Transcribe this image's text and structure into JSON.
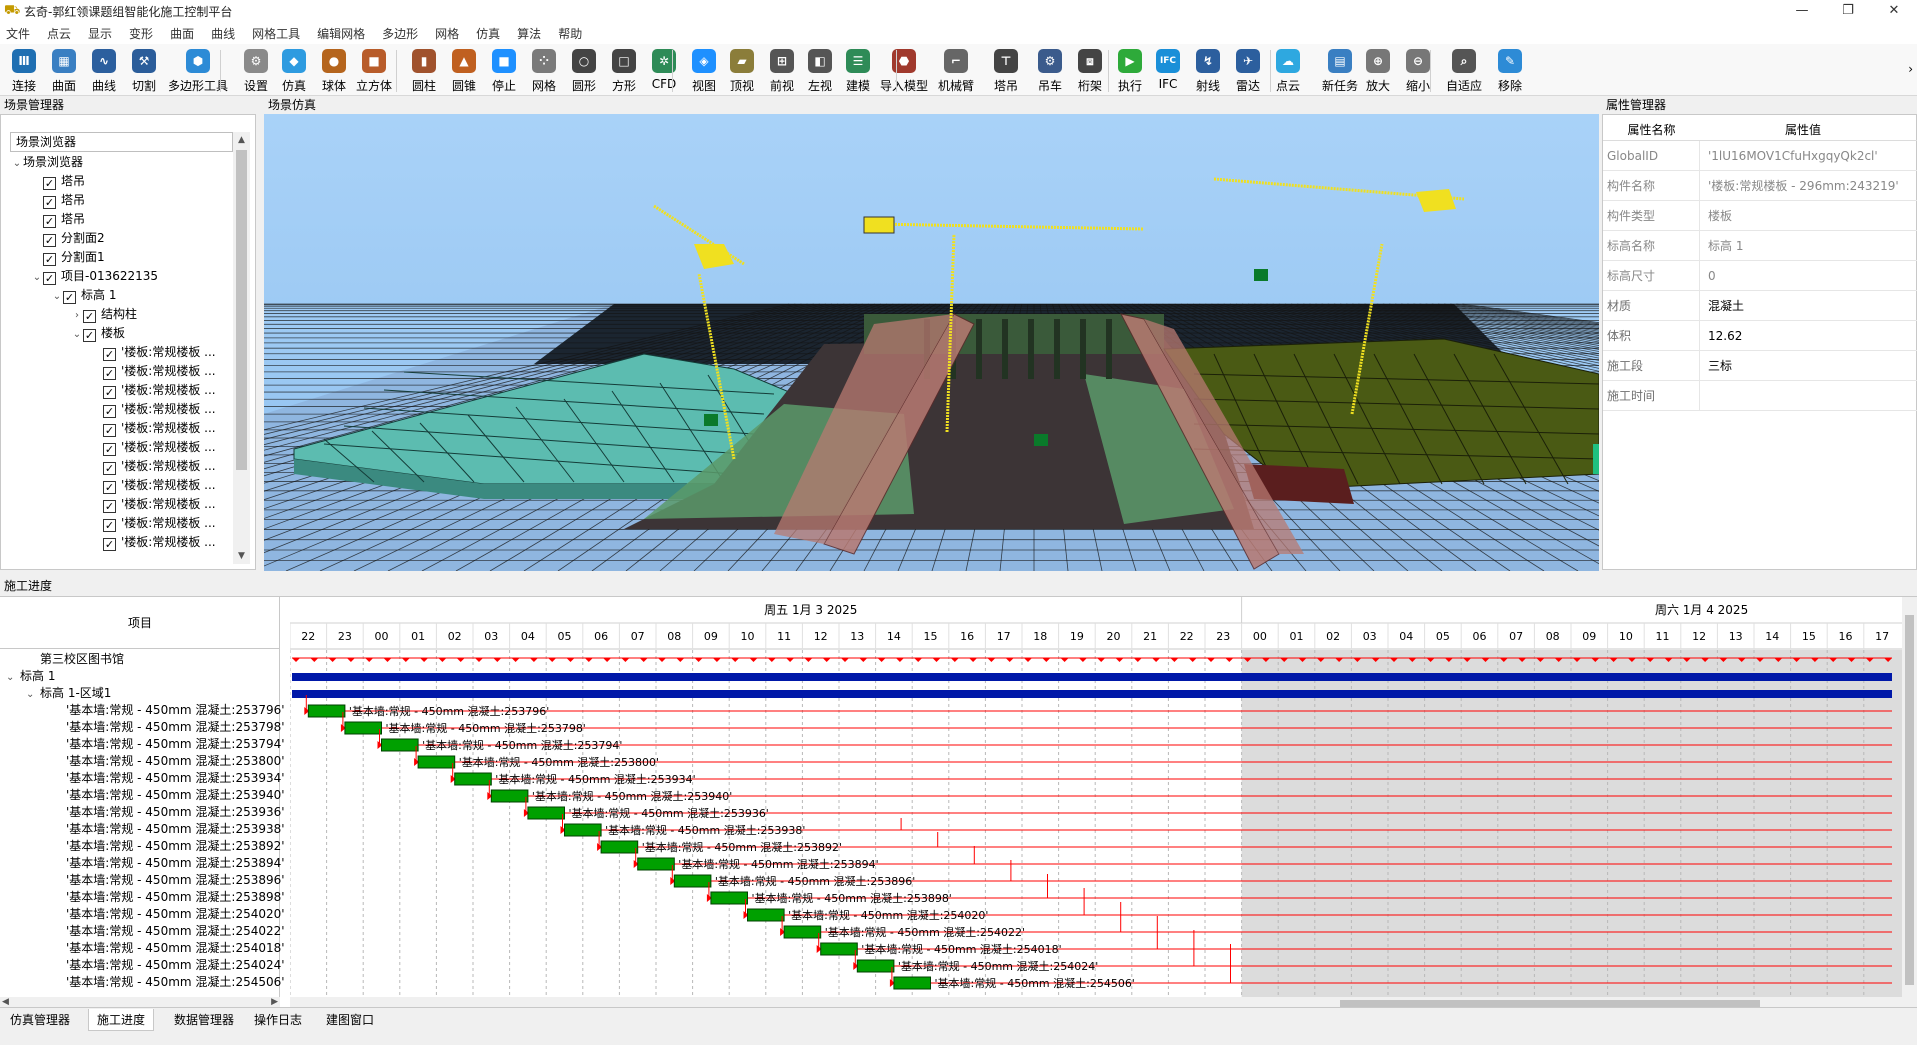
{
  "window": {
    "title": "玄奇-郭红领课题组智能化施工控制平台",
    "icon": "app-logo-icon",
    "min": "—",
    "max": "❐",
    "close": "✕"
  },
  "menu": [
    "文件",
    "点云",
    "显示",
    "变形",
    "曲面",
    "曲线",
    "网格工具",
    "编辑网格",
    "多边形",
    "网格",
    "仿真",
    "算法",
    "帮助"
  ],
  "toolbar": [
    {
      "label": "连接",
      "icon": "connect-icon",
      "color": "#1f6fb2",
      "glyph": "Ⅲ"
    },
    {
      "label": "曲面",
      "icon": "surface-icon",
      "color": "#3a7fc2",
      "glyph": "▦"
    },
    {
      "label": "曲线",
      "icon": "curve-icon",
      "color": "#2c5f9e",
      "glyph": "∿"
    },
    {
      "label": "切割",
      "icon": "cut-icon",
      "color": "#2b5d9a",
      "glyph": "⚒"
    },
    {
      "label": "多边形工具",
      "icon": "polygon-tool-icon",
      "color": "#2d8bd6",
      "glyph": "⬢"
    },
    {
      "label": "设置",
      "icon": "settings-icon",
      "color": "#8a8a8a",
      "glyph": "⚙"
    },
    {
      "label": "仿真",
      "icon": "simulation-icon",
      "color": "#2e9be0",
      "glyph": "◆"
    },
    {
      "label": "球体",
      "icon": "sphere-icon",
      "color": "#b5651d",
      "glyph": "●"
    },
    {
      "label": "立方体",
      "icon": "cube-icon",
      "color": "#b85c2a",
      "glyph": "■"
    },
    {
      "label": "圆柱",
      "icon": "cylinder-icon",
      "color": "#a0522d",
      "glyph": "▮"
    },
    {
      "label": "圆锥",
      "icon": "cone-icon",
      "color": "#c06020",
      "glyph": "▲"
    },
    {
      "label": "停止",
      "icon": "stop-icon",
      "color": "#1e90ff",
      "glyph": "■"
    },
    {
      "label": "网格",
      "icon": "mesh-icon",
      "color": "#7a7a7a",
      "glyph": "⁘"
    },
    {
      "label": "圆形",
      "icon": "circle-icon",
      "color": "#444444",
      "glyph": "○"
    },
    {
      "label": "方形",
      "icon": "square-icon",
      "color": "#444444",
      "glyph": "□"
    },
    {
      "label": "CFD",
      "icon": "cfd-icon",
      "color": "#2e8b57",
      "glyph": "✲"
    },
    {
      "label": "视图",
      "icon": "view-icon",
      "color": "#1e90ff",
      "glyph": "◈"
    },
    {
      "label": "顶视",
      "icon": "top-view-icon",
      "color": "#8b7d3a",
      "glyph": "▰"
    },
    {
      "label": "前视",
      "icon": "front-view-icon",
      "color": "#555555",
      "glyph": "⊞"
    },
    {
      "label": "左视",
      "icon": "left-view-icon",
      "color": "#555555",
      "glyph": "◧"
    },
    {
      "label": "建模",
      "icon": "modeling-icon",
      "color": "#2e8b57",
      "glyph": "☰"
    },
    {
      "label": "导入模型",
      "icon": "import-model-icon",
      "color": "#a0392d",
      "glyph": "⬣"
    },
    {
      "label": "机械臂",
      "icon": "robot-arm-icon",
      "color": "#666666",
      "glyph": "⌐"
    },
    {
      "label": "塔吊",
      "icon": "tower-crane-icon",
      "color": "#444444",
      "glyph": "⊤"
    },
    {
      "label": "吊车",
      "icon": "crane-truck-icon",
      "color": "#3b5b8c",
      "glyph": "⚙"
    },
    {
      "label": "桁架",
      "icon": "truss-icon",
      "color": "#444444",
      "glyph": "⧈"
    },
    {
      "label": "执行",
      "icon": "run-icon",
      "color": "#2eaa3a",
      "glyph": "▶"
    },
    {
      "label": "IFC",
      "icon": "ifc-icon",
      "color": "#1a8fd8",
      "glyph": "IFC"
    },
    {
      "label": "射线",
      "icon": "ray-icon",
      "color": "#2c5f9e",
      "glyph": "↯"
    },
    {
      "label": "雷达",
      "icon": "radar-icon",
      "color": "#2c5f9e",
      "glyph": "✈"
    },
    {
      "label": "点云",
      "icon": "point-cloud-icon",
      "color": "#2ea8e0",
      "glyph": "☁"
    },
    {
      "label": "新任务",
      "icon": "new-task-icon",
      "color": "#3a7fc2",
      "glyph": "▤"
    },
    {
      "label": "放大",
      "icon": "zoom-in-icon",
      "color": "#777777",
      "glyph": "⊕"
    },
    {
      "label": "缩小",
      "icon": "zoom-out-icon",
      "color": "#777777",
      "glyph": "⊖"
    },
    {
      "label": "自适应",
      "icon": "fit-view-icon",
      "color": "#555555",
      "glyph": "⌕"
    },
    {
      "label": "移除",
      "icon": "remove-icon",
      "color": "#2d8bd6",
      "glyph": "✎"
    }
  ],
  "panels": {
    "scene_manager": "场景管理器",
    "scene_view": "场景仿真",
    "property_manager": "属性管理器",
    "construction_progress": "施工进度"
  },
  "scene_tree": {
    "header": "场景浏览器",
    "items": [
      {
        "label": "场景浏览器",
        "level": 0,
        "twisty": "⌄",
        "check": false
      },
      {
        "label": "塔吊",
        "level": 1,
        "twisty": "",
        "check": true
      },
      {
        "label": "塔吊",
        "level": 1,
        "twisty": "",
        "check": true
      },
      {
        "label": "塔吊",
        "level": 1,
        "twisty": "",
        "check": true
      },
      {
        "label": "分割面2",
        "level": 1,
        "twisty": "",
        "check": true
      },
      {
        "label": "分割面1",
        "level": 1,
        "twisty": "",
        "check": true
      },
      {
        "label": "项目-013622135",
        "level": 1,
        "twisty": "⌄",
        "check": true
      },
      {
        "label": "标高 1",
        "level": 2,
        "twisty": "⌄",
        "check": true
      },
      {
        "label": "结构柱",
        "level": 3,
        "twisty": "›",
        "check": true
      },
      {
        "label": "楼板",
        "level": 3,
        "twisty": "⌄",
        "check": true
      },
      {
        "label": "'楼板:常规楼板 ...",
        "level": 4,
        "twisty": "",
        "check": true
      },
      {
        "label": "'楼板:常规楼板 ...",
        "level": 4,
        "twisty": "",
        "check": true
      },
      {
        "label": "'楼板:常规楼板 ...",
        "level": 4,
        "twisty": "",
        "check": true
      },
      {
        "label": "'楼板:常规楼板 ...",
        "level": 4,
        "twisty": "",
        "check": true
      },
      {
        "label": "'楼板:常规楼板 ...",
        "level": 4,
        "twisty": "",
        "check": true
      },
      {
        "label": "'楼板:常规楼板 ...",
        "level": 4,
        "twisty": "",
        "check": true
      },
      {
        "label": "'楼板:常规楼板 ...",
        "level": 4,
        "twisty": "",
        "check": true
      },
      {
        "label": "'楼板:常规楼板 ...",
        "level": 4,
        "twisty": "",
        "check": true
      },
      {
        "label": "'楼板:常规楼板 ...",
        "level": 4,
        "twisty": "",
        "check": true
      },
      {
        "label": "'楼板:常规楼板 ...",
        "level": 4,
        "twisty": "",
        "check": true
      },
      {
        "label": "'楼板:常规楼板 ...",
        "level": 4,
        "twisty": "",
        "check": true
      }
    ]
  },
  "properties": {
    "header": {
      "name": "属性名称",
      "value": "属性值"
    },
    "rows": [
      {
        "name": "GlobalID",
        "value": "'1lU16MOV1CfuHxgqyQk2cl'",
        "meta": true
      },
      {
        "name": "构件名称",
        "value": "'楼板:常规楼板 - 296mm:243219'",
        "meta": true
      },
      {
        "name": "构件类型",
        "value": "楼板",
        "meta": true
      },
      {
        "name": "标高名称",
        "value": "标高 1",
        "meta": true
      },
      {
        "name": "标高尺寸",
        "value": "0",
        "meta": true
      },
      {
        "name": "材质",
        "value": "混凝土",
        "meta": false
      },
      {
        "name": "体积",
        "value": "12.62",
        "meta": false
      },
      {
        "name": "施工段",
        "value": "三标",
        "meta": false
      },
      {
        "name": "施工时间",
        "value": "",
        "meta": false
      }
    ]
  },
  "gantt": {
    "column_header": "项目",
    "day1": "周五  1月  3  2025",
    "day2": "周六  1月  4  2025",
    "hours": [
      "22",
      "23",
      "00",
      "01",
      "02",
      "03",
      "04",
      "05",
      "06",
      "07",
      "08",
      "09",
      "10",
      "11",
      "12",
      "13",
      "14",
      "15",
      "16",
      "17",
      "18",
      "19",
      "20",
      "21",
      "22",
      "23",
      "00",
      "01",
      "02",
      "03",
      "04",
      "05",
      "06",
      "07",
      "08",
      "09",
      "10",
      "11",
      "12",
      "13",
      "14",
      "15",
      "16",
      "17"
    ],
    "groups": [
      {
        "label": "第三校区图书馆",
        "indent": 1,
        "twisty": ""
      },
      {
        "label": "标高 1",
        "indent": 0,
        "twisty": "⌄"
      },
      {
        "label": "标高 1-区域1",
        "indent": 1,
        "twisty": "⌄"
      }
    ],
    "tasks": [
      {
        "label": "'基本墙:常规 - 450mm 混凝土:253796'",
        "start_hour": 0.5,
        "duration_hours": 1
      },
      {
        "label": "'基本墙:常规 - 450mm 混凝土:253798'",
        "start_hour": 1.5,
        "duration_hours": 1
      },
      {
        "label": "'基本墙:常规 - 450mm 混凝土:253794'",
        "start_hour": 2.5,
        "duration_hours": 1
      },
      {
        "label": "'基本墙:常规 - 450mm 混凝土:253800'",
        "start_hour": 3.5,
        "duration_hours": 1
      },
      {
        "label": "'基本墙:常规 - 450mm 混凝土:253934'",
        "start_hour": 4.5,
        "duration_hours": 1
      },
      {
        "label": "'基本墙:常规 - 450mm 混凝土:253940'",
        "start_hour": 5.5,
        "duration_hours": 1
      },
      {
        "label": "'基本墙:常规 - 450mm 混凝土:253936'",
        "start_hour": 6.5,
        "duration_hours": 1
      },
      {
        "label": "'基本墙:常规 - 450mm 混凝土:253938'",
        "start_hour": 7.5,
        "duration_hours": 1
      },
      {
        "label": "'基本墙:常规 - 450mm 混凝土:253892'",
        "start_hour": 8.5,
        "duration_hours": 1
      },
      {
        "label": "'基本墙:常规 - 450mm 混凝土:253894'",
        "start_hour": 9.5,
        "duration_hours": 1
      },
      {
        "label": "'基本墙:常规 - 450mm 混凝土:253896'",
        "start_hour": 10.5,
        "duration_hours": 1
      },
      {
        "label": "'基本墙:常规 - 450mm 混凝土:253898'",
        "start_hour": 11.5,
        "duration_hours": 1
      },
      {
        "label": "'基本墙:常规 - 450mm 混凝土:254020'",
        "start_hour": 12.5,
        "duration_hours": 1
      },
      {
        "label": "'基本墙:常规 - 450mm 混凝土:254022'",
        "start_hour": 13.5,
        "duration_hours": 1
      },
      {
        "label": "'基本墙:常规 - 450mm 混凝土:254018'",
        "start_hour": 14.5,
        "duration_hours": 1
      },
      {
        "label": "'基本墙:常规 - 450mm 混凝土:254024'",
        "start_hour": 15.5,
        "duration_hours": 1
      },
      {
        "label": "'基本墙:常规 - 450mm 混凝土:254506'",
        "start_hour": 16.5,
        "duration_hours": 1
      }
    ]
  },
  "bottom_tabs": [
    {
      "label": "仿真管理器",
      "active": false
    },
    {
      "label": "施工进度",
      "active": true
    },
    {
      "label": "数据管理器",
      "active": false
    },
    {
      "label": "操作日志",
      "active": false
    },
    {
      "label": "建图窗口",
      "active": false
    }
  ],
  "colors": {
    "sky": "#9dc8f0",
    "grid_line": "#141414",
    "plane_blue": "#8fb6e0",
    "wall_teal": "#5cbcb0",
    "wall_olive": "#4a5a14",
    "wall_green": "#5a9a6a",
    "cut_plane": "#b87a72",
    "crane_yellow": "#f0e020",
    "bar_green": "#00a000",
    "summary_blue": "#0018a8",
    "link_red": "#ff0000",
    "weekend_grey": "#dcdcdc"
  }
}
